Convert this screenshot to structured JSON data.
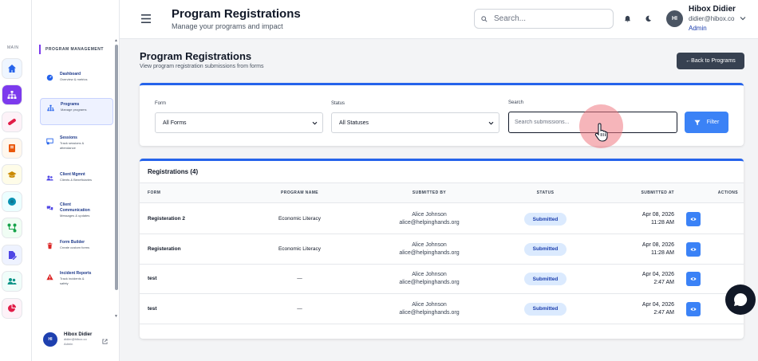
{
  "rail": {
    "label": "MAIN",
    "items": [
      {
        "icon": "home-icon",
        "color": "#2563eb",
        "bg": "#eff6ff"
      },
      {
        "icon": "sitemap-icon",
        "color": "#ffffff",
        "bg": "#7c3aed"
      },
      {
        "icon": "bandage-icon",
        "color": "#e11d48",
        "bg": "#fdf2f8"
      },
      {
        "icon": "book-icon",
        "color": "#ea580c",
        "bg": "#fff7ed"
      },
      {
        "icon": "graduation-cap-icon",
        "color": "#ca8a04",
        "bg": "#fefce8"
      },
      {
        "icon": "circle-dot-icon",
        "color": "#0891b2",
        "bg": "#ecfeff"
      },
      {
        "icon": "network-icon",
        "color": "#16a34a",
        "bg": "#f0fdf4"
      },
      {
        "icon": "file-edit-icon",
        "color": "#4f46e5",
        "bg": "#eef2ff"
      },
      {
        "icon": "users-icon",
        "color": "#0d9488",
        "bg": "#f0fdfa"
      },
      {
        "icon": "pie-chart-icon",
        "color": "#e11d48",
        "bg": "#fdf2f8"
      }
    ]
  },
  "sidebar": {
    "section": "PROGRAM MANAGEMENT",
    "items": [
      {
        "title": "Dashboard",
        "desc": [
          "Overview & metrics"
        ],
        "icon": "gauge-icon",
        "color": "#2563eb"
      },
      {
        "title": "Programs",
        "desc": [
          "Manage programs"
        ],
        "icon": "sitemap-icon",
        "color": "#2563eb"
      },
      {
        "title": "Sessions",
        "desc": [
          "Track sessions &",
          "attendance"
        ],
        "icon": "chalkboard-icon",
        "color": "#2563eb"
      },
      {
        "title": "Client Mgmnt",
        "desc": [
          "Clients & Beneficiaries"
        ],
        "icon": "users-icon",
        "color": "#4f46e5"
      },
      {
        "title": "Client",
        "title2": "Communication",
        "desc": [
          "Messages & updates"
        ],
        "icon": "comments-icon",
        "color": "#4f46e5"
      },
      {
        "title": "Form Builder",
        "desc": [
          "Create custom forms"
        ],
        "icon": "trash-icon",
        "color": "#dc2626"
      },
      {
        "title": "Incident Reports",
        "desc": [
          "Track incidents &",
          "safety"
        ],
        "icon": "warning-icon",
        "color": "#dc2626"
      }
    ],
    "user": {
      "initials": "HI",
      "name": "Hibox Didier",
      "email": "didier@hibox.co",
      "role": "Admin"
    }
  },
  "header": {
    "title": "Program Registrations",
    "subtitle": "Manage your programs and impact",
    "search_placeholder": "Search...",
    "user": {
      "initials": "HI",
      "name": "Hibox Didier",
      "email": "didier@hibox.co",
      "role": "Admin"
    }
  },
  "main": {
    "title": "Program Registrations",
    "subtitle": "View program registration submissions from forms",
    "back_label": "←Back to Programs",
    "filters": {
      "form_label": "Form",
      "form_value": "All Forms",
      "status_label": "Status",
      "status_value": "All Statuses",
      "search_label": "Search",
      "search_placeholder": "Search submissions...",
      "filter_label": "Filter"
    },
    "table": {
      "title": "Registrations (4)",
      "columns": [
        "FORM",
        "PROGRAM NAME",
        "SUBMITTED BY",
        "STATUS",
        "SUBMITTED AT",
        "ACTIONS"
      ],
      "rows": [
        {
          "form": "Registeration 2",
          "program": "Economic Literacy",
          "by_name": "Alice Johnson",
          "by_email": "alice@helpinghands.org",
          "status": "Submitted",
          "date": "Apr 08, 2026",
          "time": "11:28 AM"
        },
        {
          "form": "Registeration",
          "program": "Economic Literacy",
          "by_name": "Alice Johnson",
          "by_email": "alice@helpinghands.org",
          "status": "Submitted",
          "date": "Apr 08, 2026",
          "time": "11:28 AM"
        },
        {
          "form": "test",
          "program": "—",
          "by_name": "Alice Johnson",
          "by_email": "alice@helpinghands.org",
          "status": "Submitted",
          "date": "Apr 04, 2026",
          "time": "2:47 AM"
        },
        {
          "form": "test",
          "program": "—",
          "by_name": "Alice Johnson",
          "by_email": "alice@helpinghands.org",
          "status": "Submitted",
          "date": "Apr 04, 2026",
          "time": "2:47 AM"
        }
      ]
    }
  },
  "colors": {
    "accent": "#2563eb",
    "brand": "#7c3aed",
    "badge_bg": "#dbeafe",
    "badge_text": "#1e40af",
    "button_dark": "#374151"
  }
}
